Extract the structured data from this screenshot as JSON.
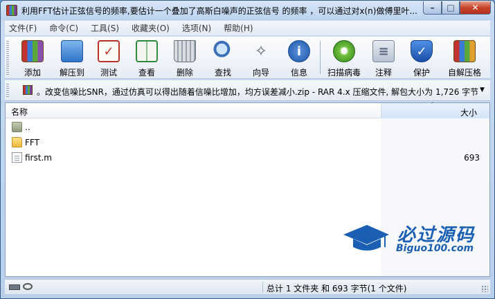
{
  "window": {
    "title": "利用FFT估计正弦信号的频率,要估计一个叠加了高斯白噪声的正弦信号 的频率 ，可以通过对x(n)做傅里叶..."
  },
  "menu": [
    "文件(F)",
    "命令(C)",
    "工具(S)",
    "收藏夹(O)",
    "选项(N)",
    "帮助(H)"
  ],
  "toolbar": {
    "add": "添加",
    "extract": "解压到",
    "test": "测试",
    "view": "查看",
    "delete": "删除",
    "find": "查找",
    "wizard": "向导",
    "info": "信息",
    "scan": "扫描病毒",
    "comment": "注释",
    "protect": "保护",
    "sfx": "自解压格"
  },
  "address": {
    "text": "。改变信噪比SNR，通过仿真可以得出随着信噪比增加，均方误差减小.zip - RAR 4.x 压缩文件, 解包大小为 1,726 字节"
  },
  "columns": {
    "name": "名称",
    "size": "大小"
  },
  "files": [
    {
      "name": "..",
      "size": ""
    },
    {
      "name": "FFT",
      "size": ""
    },
    {
      "name": "first.m",
      "size": "693"
    }
  ],
  "watermark": {
    "title": "必过源码",
    "url": "Biguo100.com"
  },
  "status": {
    "summary": "总计 1 文件夹 和 693 字节(1 个文件)"
  },
  "colors": {
    "title_bg": "#bcd3ef",
    "watermark": "#1a5fb4",
    "close_button": "#c7432a"
  }
}
